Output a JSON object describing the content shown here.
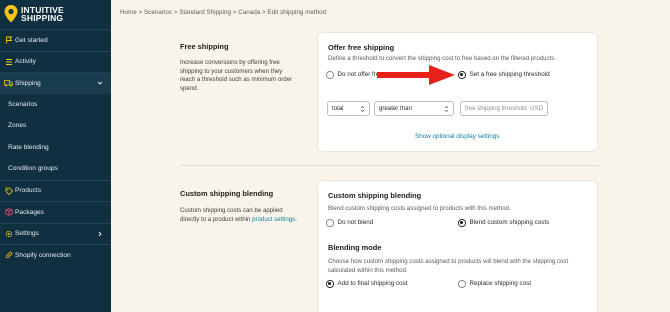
{
  "brand": {
    "line1": "INTUITIVE",
    "line2": "SHIPPING"
  },
  "sidebar": {
    "items": [
      {
        "label": "Get started",
        "icon": "flag-icon"
      },
      {
        "label": "Activity",
        "icon": "list-icon"
      },
      {
        "label": "Shipping",
        "icon": "truck-icon"
      },
      {
        "label": "Scenarios"
      },
      {
        "label": "Zones"
      },
      {
        "label": "Rate blending"
      },
      {
        "label": "Condition groups"
      },
      {
        "label": "Products",
        "icon": "tag-icon"
      },
      {
        "label": "Packages",
        "icon": "box-icon"
      },
      {
        "label": "Settings",
        "icon": "gear-icon"
      },
      {
        "label": "Shopify connection",
        "icon": "link-icon"
      }
    ]
  },
  "breadcrumb": "Home > Scenarios > Standard Shipping > Canada > Edit shipping method",
  "free_shipping_section": {
    "title": "Free shipping",
    "description": "Increase conversions by offering free shipping to your customers when they reach a threshold such as minimum order spend."
  },
  "offer_card": {
    "title": "Offer free shipping",
    "subtitle": "Define a threshold to convert the shipping cost to free based on the filtered products.",
    "option_off": "Do not offer free s",
    "option_on": "Set a free shipping threshold",
    "select_metric": "total",
    "select_operator": "greater than",
    "threshold_placeholder": "free shipping threshold",
    "threshold_unit": "USD",
    "display_link": "Show optional display settings"
  },
  "custom_section": {
    "title": "Custom shipping blending",
    "description_pre": "Custom shipping costs can be applied directly to a product within ",
    "description_link": "product settings",
    "description_post": "."
  },
  "blending_card": {
    "title": "Custom shipping blending",
    "subtitle": "Blend custom shipping costs assigned to products with this method.",
    "option_no": "Do not blend",
    "option_yes": "Blend custom shipping costs",
    "mode_title": "Blending mode",
    "mode_subtitle": "Choose how custom shipping costs assigned to products will blend with the shipping cost calculated within this method.",
    "mode_add": "Add to final shipping cost",
    "mode_replace": "Replace shipping cost"
  },
  "colors": {
    "sidebar_bg": "#11303f",
    "page_bg": "#f8f4ea",
    "link": "#0e7fa0",
    "annotation_arrow": "#e8221b",
    "logo_yellow": "#f5c518"
  }
}
